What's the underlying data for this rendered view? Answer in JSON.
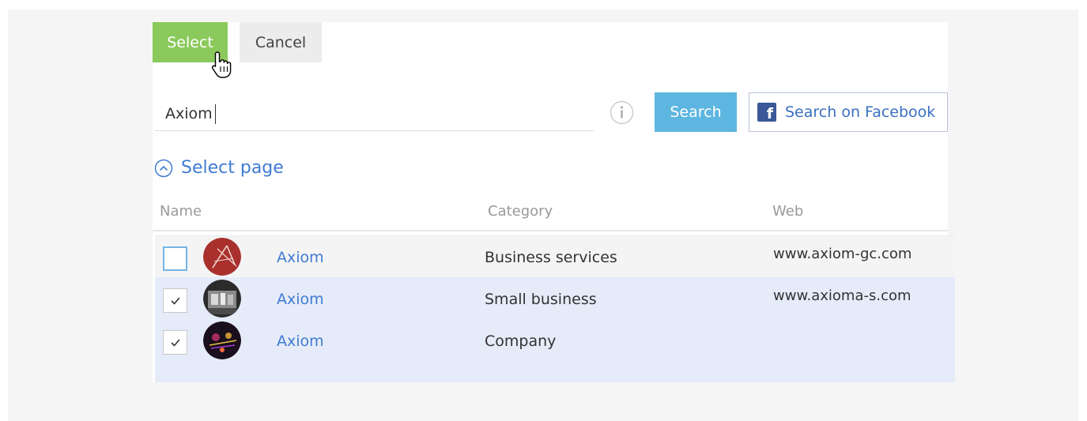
{
  "toolbar": {
    "select_label": "Select",
    "cancel_label": "Cancel"
  },
  "search": {
    "value": "Axiom",
    "button_label": "Search",
    "facebook_label": "Search on Facebook"
  },
  "section": {
    "title": "Select page"
  },
  "table": {
    "headers": {
      "name": "Name",
      "category": "Category",
      "web": "Web"
    },
    "rows": [
      {
        "name": "Axiom",
        "category": "Business services",
        "web": "www.axiom-gc.com",
        "checked": false,
        "avatar": "axiom-logo-avatar"
      },
      {
        "name": "Axiom",
        "category": "Small business",
        "web": "www.axioma-s.com",
        "checked": true,
        "avatar": "photo-avatar"
      },
      {
        "name": "Axiom",
        "category": "Company",
        "web": "",
        "checked": true,
        "avatar": "concert-photo-avatar"
      }
    ]
  },
  "colors": {
    "select_green": "#8bc95c",
    "search_blue": "#5db6e0",
    "link_blue": "#3f7bd3",
    "selected_row": "#e5ebf8",
    "facebook_blue": "#3b5998"
  },
  "icons": {
    "cursor": "hand-pointer-icon",
    "info": "info-icon",
    "facebook": "facebook-icon",
    "toggle": "chevron-up-circle-icon",
    "check": "checkmark-icon"
  }
}
